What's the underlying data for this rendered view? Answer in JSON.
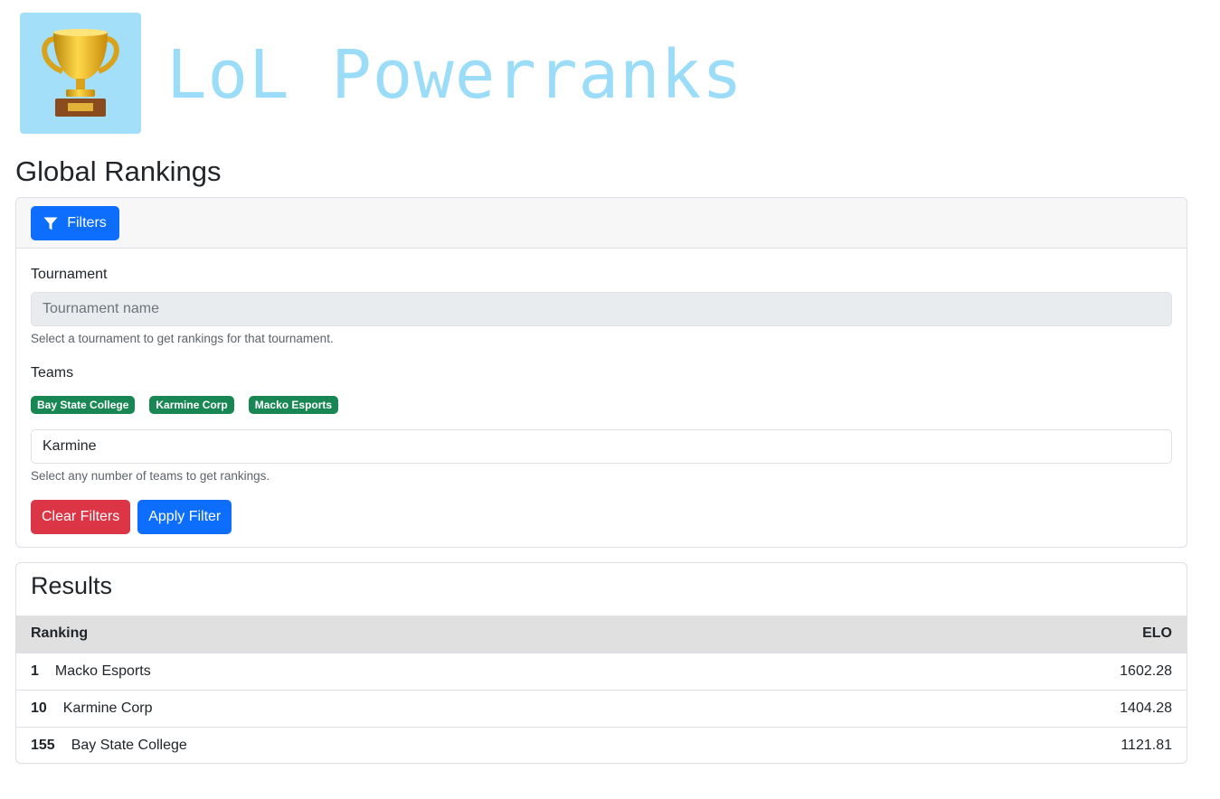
{
  "header": {
    "logo_icon": "trophy-icon",
    "site_title": "LoL Powerranks"
  },
  "page_title": "Global Rankings",
  "filters": {
    "toggle_label": "Filters",
    "toggle_icon": "filter-icon",
    "tournament": {
      "label": "Tournament",
      "placeholder": "Tournament name",
      "help": "Select a tournament to get rankings for that tournament."
    },
    "teams": {
      "label": "Teams",
      "selected": [
        "Bay State College",
        "Karmine Corp",
        "Macko Esports"
      ],
      "input_value": "Karmine",
      "help": "Select any number of teams to get rankings."
    },
    "clear_label": "Clear Filters",
    "apply_label": "Apply Filter"
  },
  "results": {
    "title": "Results",
    "columns": [
      "Ranking",
      "ELO"
    ],
    "rows": [
      {
        "rank": "1",
        "team": "Macko Esports",
        "elo": "1602.28"
      },
      {
        "rank": "10",
        "team": "Karmine Corp",
        "elo": "1404.28"
      },
      {
        "rank": "155",
        "team": "Bay State College",
        "elo": "1121.81"
      }
    ]
  },
  "colors": {
    "primary": "#0d6efd",
    "danger": "#dc3545",
    "badge": "#198754",
    "logo_bg": "#a3dff9",
    "title": "#9bddf8"
  }
}
